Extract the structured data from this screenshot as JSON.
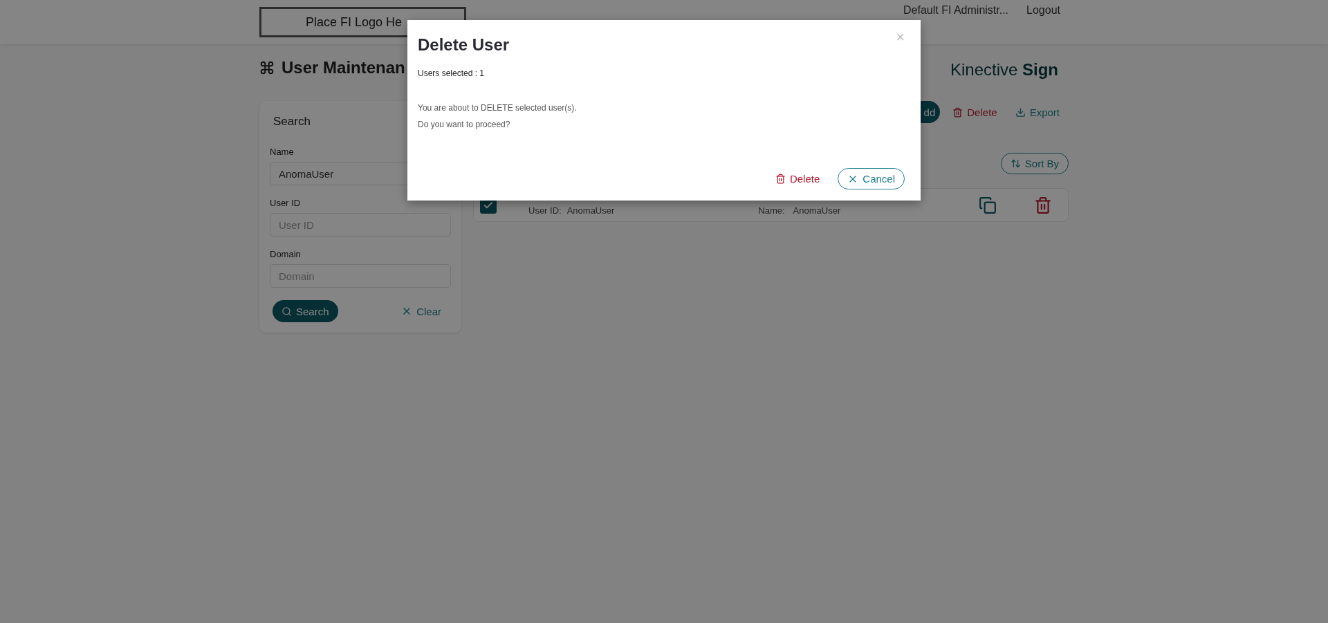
{
  "header": {
    "logo_text": "Place FI Logo He",
    "nav": [
      {
        "label": "Default FI Administr..."
      },
      {
        "label": "Logout"
      }
    ]
  },
  "page": {
    "title": "User Maintenan",
    "brand": "Kinective **Sign**"
  },
  "search": {
    "title": "Search",
    "fields": [
      {
        "label": "Name",
        "value": "AnomaUser"
      },
      {
        "label": "User ID",
        "placeholder": "User ID"
      },
      {
        "label": "Domain",
        "placeholder": "Domain"
      }
    ],
    "search_button": "Search",
    "clear_button": "Clear"
  },
  "toolbar": {
    "add_button": "dd",
    "delete_button": "Delete",
    "export_button": "Export",
    "sort_button": "Sort By"
  },
  "rows": [
    {
      "selected": true,
      "user_id_label": "User ID:",
      "user_id": "AnomaUser",
      "name_label": "Name:",
      "name": "AnomaUser"
    }
  ],
  "modal": {
    "title": "Delete User",
    "close": "×",
    "count_text": "Users selected : 1",
    "message": [
      "You are about to DELETE selected user(s).",
      "Do you want to proceed?"
    ],
    "delete_button": "Delete",
    "cancel_button": "Cancel"
  }
}
